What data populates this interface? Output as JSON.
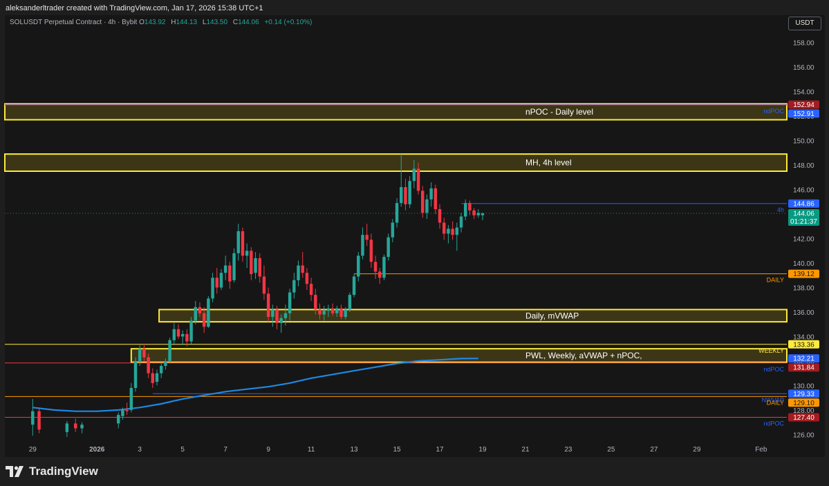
{
  "header": {
    "credit": "aleksanderltrader created with TradingView.com, Jan 17, 2026 15:38 UTC+1",
    "symbol": "SOLUSDT Perpetual Contract · 4h · Bybit",
    "ohlc": {
      "o_label": "O",
      "o": "143.92",
      "h_label": "H",
      "h": "144.13",
      "l_label": "L",
      "l": "143.50",
      "c_label": "C",
      "c": "144.06",
      "change": "+0.14 (+0.10%)"
    },
    "currency": "USDT"
  },
  "logo": {
    "text": "TradingView",
    "icon": "tradingview-logo-icon"
  },
  "chart_data": {
    "type": "candlestick",
    "ylim": [
      125.4,
      159.0
    ],
    "yticks": [
      "126.00",
      "128.00",
      "130.00",
      "132.00",
      "134.00",
      "136.00",
      "138.00",
      "140.00",
      "142.00",
      "144.00",
      "146.00",
      "148.00",
      "150.00",
      "152.00",
      "154.00",
      "156.00",
      "158.00"
    ],
    "xlim": [
      -1.3,
      35.2
    ],
    "xtick_labels": [
      {
        "pos": 0,
        "label": "29"
      },
      {
        "pos": 3,
        "label": "2026"
      },
      {
        "pos": 5,
        "label": "3"
      },
      {
        "pos": 7,
        "label": "5"
      },
      {
        "pos": 9,
        "label": "7"
      },
      {
        "pos": 11,
        "label": "9"
      },
      {
        "pos": 13,
        "label": "11"
      },
      {
        "pos": 15,
        "label": "13"
      },
      {
        "pos": 17,
        "label": "15"
      },
      {
        "pos": 19,
        "label": "17"
      },
      {
        "pos": 21,
        "label": "19"
      },
      {
        "pos": 23,
        "label": "21"
      },
      {
        "pos": 25,
        "label": "23"
      },
      {
        "pos": 27,
        "label": "25"
      },
      {
        "pos": 29,
        "label": "27"
      },
      {
        "pos": 31,
        "label": "29"
      },
      {
        "pos": 34,
        "label": "Feb"
      }
    ],
    "candles": [
      [
        0.0,
        126.8,
        128.9,
        125.9,
        127.9
      ],
      [
        0.3,
        127.9,
        128.2,
        126.1,
        126.4
      ],
      [
        1.6,
        126.2,
        127.1,
        125.8,
        126.9
      ],
      [
        2.0,
        126.9,
        127.3,
        126.2,
        126.5
      ],
      [
        2.3,
        126.5,
        127.0,
        126.1,
        126.8
      ],
      [
        4.0,
        126.9,
        127.8,
        126.5,
        127.6
      ],
      [
        4.2,
        127.5,
        128.2,
        127.2,
        128.0
      ],
      [
        4.4,
        128.0,
        128.6,
        127.6,
        127.9
      ],
      [
        4.6,
        128.0,
        130.2,
        127.8,
        129.8
      ],
      [
        4.8,
        129.8,
        132.3,
        129.5,
        132.0
      ],
      [
        5.0,
        132.0,
        133.3,
        131.6,
        133.0
      ],
      [
        5.2,
        133.0,
        133.4,
        132.0,
        132.3
      ],
      [
        5.4,
        132.3,
        132.6,
        130.6,
        131.0
      ],
      [
        5.6,
        131.0,
        131.4,
        129.8,
        130.2
      ],
      [
        5.8,
        130.3,
        131.3,
        130.0,
        131.0
      ],
      [
        6.0,
        131.0,
        131.9,
        130.6,
        131.6
      ],
      [
        6.2,
        131.6,
        132.2,
        131.3,
        132.0
      ],
      [
        6.4,
        132.0,
        133.9,
        131.9,
        133.7
      ],
      [
        6.6,
        133.7,
        135.1,
        133.3,
        134.6
      ],
      [
        6.8,
        134.6,
        135.0,
        133.8,
        134.0
      ],
      [
        7.0,
        134.0,
        134.5,
        133.3,
        134.2
      ],
      [
        7.2,
        134.2,
        134.6,
        133.2,
        133.6
      ],
      [
        7.4,
        133.6,
        135.6,
        133.4,
        135.3
      ],
      [
        7.6,
        135.3,
        136.9,
        135.0,
        136.4
      ],
      [
        7.8,
        136.4,
        136.8,
        135.6,
        135.9
      ],
      [
        8.0,
        135.9,
        136.4,
        134.3,
        134.8
      ],
      [
        8.2,
        134.8,
        137.3,
        134.7,
        137.1
      ],
      [
        8.4,
        137.1,
        139.2,
        136.8,
        138.8
      ],
      [
        8.6,
        138.8,
        139.6,
        137.5,
        138.0
      ],
      [
        8.8,
        138.0,
        139.5,
        137.8,
        139.2
      ],
      [
        9.0,
        139.2,
        140.6,
        138.6,
        139.8
      ],
      [
        9.2,
        139.8,
        140.1,
        137.9,
        138.5
      ],
      [
        9.4,
        138.6,
        141.2,
        138.4,
        140.8
      ],
      [
        9.6,
        140.8,
        143.2,
        140.2,
        142.6
      ],
      [
        9.8,
        142.6,
        142.9,
        140.1,
        140.6
      ],
      [
        10.0,
        140.6,
        141.6,
        139.6,
        141.0
      ],
      [
        10.2,
        141.0,
        141.3,
        138.6,
        139.1
      ],
      [
        10.4,
        139.2,
        140.9,
        138.7,
        140.4
      ],
      [
        10.6,
        140.4,
        140.8,
        138.4,
        138.9
      ],
      [
        10.8,
        138.9,
        139.8,
        137.0,
        137.5
      ],
      [
        11.0,
        137.5,
        138.0,
        135.2,
        135.6
      ],
      [
        11.2,
        135.6,
        136.6,
        134.8,
        136.2
      ],
      [
        11.4,
        136.2,
        136.5,
        134.6,
        135.1
      ],
      [
        11.6,
        135.1,
        135.8,
        134.3,
        135.5
      ],
      [
        11.8,
        135.5,
        136.6,
        134.9,
        135.9
      ],
      [
        12.0,
        135.9,
        137.9,
        135.3,
        137.6
      ],
      [
        12.2,
        137.6,
        139.2,
        137.1,
        138.6
      ],
      [
        12.4,
        138.6,
        140.2,
        138.1,
        139.8
      ],
      [
        12.6,
        139.8,
        140.9,
        138.8,
        139.2
      ],
      [
        12.8,
        139.2,
        139.6,
        137.8,
        138.3
      ],
      [
        13.0,
        138.3,
        138.8,
        136.9,
        137.4
      ],
      [
        13.2,
        137.4,
        137.9,
        135.8,
        136.2
      ],
      [
        13.4,
        136.2,
        136.7,
        135.4,
        135.8
      ],
      [
        13.6,
        135.8,
        136.5,
        135.3,
        136.1
      ],
      [
        13.8,
        136.1,
        136.6,
        135.6,
        136.3
      ],
      [
        14.0,
        136.3,
        136.7,
        135.7,
        135.9
      ],
      [
        14.2,
        135.9,
        136.5,
        135.6,
        136.3
      ],
      [
        14.4,
        136.3,
        136.6,
        135.4,
        135.6
      ],
      [
        14.6,
        135.6,
        136.4,
        135.4,
        136.2
      ],
      [
        14.8,
        136.2,
        137.6,
        136.0,
        137.4
      ],
      [
        15.0,
        137.4,
        139.1,
        137.2,
        138.9
      ],
      [
        15.2,
        138.9,
        140.9,
        138.5,
        140.6
      ],
      [
        15.4,
        140.6,
        142.9,
        140.3,
        142.3
      ],
      [
        15.6,
        142.3,
        143.2,
        141.4,
        141.9
      ],
      [
        15.8,
        141.9,
        142.4,
        139.6,
        140.1
      ],
      [
        16.0,
        140.1,
        140.6,
        138.7,
        139.3
      ],
      [
        16.2,
        139.3,
        139.6,
        138.3,
        138.8
      ],
      [
        16.4,
        138.8,
        140.7,
        138.6,
        140.5
      ],
      [
        16.6,
        140.5,
        142.4,
        140.2,
        142.1
      ],
      [
        16.8,
        142.1,
        143.6,
        141.7,
        143.3
      ],
      [
        17.0,
        143.3,
        145.3,
        142.9,
        144.9
      ],
      [
        17.2,
        144.9,
        148.9,
        144.6,
        146.2
      ],
      [
        17.4,
        146.2,
        146.9,
        144.3,
        144.8
      ],
      [
        17.6,
        144.8,
        147.1,
        144.5,
        146.7
      ],
      [
        17.8,
        146.7,
        148.4,
        146.1,
        147.7
      ],
      [
        18.0,
        147.7,
        148.2,
        145.6,
        145.9
      ],
      [
        18.2,
        145.9,
        146.3,
        143.7,
        144.1
      ],
      [
        18.4,
        144.1,
        145.6,
        143.6,
        145.2
      ],
      [
        18.6,
        145.2,
        146.6,
        144.6,
        146.1
      ],
      [
        18.8,
        146.1,
        146.4,
        144.0,
        144.4
      ],
      [
        19.0,
        144.4,
        144.8,
        142.8,
        143.3
      ],
      [
        19.2,
        143.3,
        143.7,
        141.9,
        142.4
      ],
      [
        19.4,
        142.4,
        143.1,
        141.6,
        142.8
      ],
      [
        19.6,
        142.8,
        143.4,
        141.9,
        142.3
      ],
      [
        19.8,
        142.3,
        143.3,
        141.0,
        142.9
      ],
      [
        20.0,
        142.9,
        144.1,
        142.5,
        143.8
      ],
      [
        20.2,
        143.8,
        145.2,
        143.5,
        144.9
      ],
      [
        20.4,
        144.9,
        145.1,
        143.9,
        144.3
      ],
      [
        20.6,
        144.3,
        144.5,
        143.6,
        143.9
      ],
      [
        20.8,
        143.9,
        144.4,
        143.7,
        144.1
      ],
      [
        21.0,
        143.9,
        144.13,
        143.5,
        144.06
      ]
    ],
    "vwap": [
      [
        0,
        128.2
      ],
      [
        1,
        128.0
      ],
      [
        2,
        127.9
      ],
      [
        3,
        127.9
      ],
      [
        4,
        128.0
      ],
      [
        5,
        128.2
      ],
      [
        6,
        128.5
      ],
      [
        7,
        128.9
      ],
      [
        8,
        129.2
      ],
      [
        9,
        129.5
      ],
      [
        10,
        129.7
      ],
      [
        11,
        129.9
      ],
      [
        12,
        130.2
      ],
      [
        13,
        130.6
      ],
      [
        14,
        130.9
      ],
      [
        15,
        131.2
      ],
      [
        16,
        131.5
      ],
      [
        17,
        131.8
      ],
      [
        18,
        132.0
      ],
      [
        19,
        132.1
      ],
      [
        20,
        132.2
      ],
      [
        20.8,
        132.21
      ]
    ],
    "zones": [
      {
        "label": "nPOC - Daily level",
        "from_x": -1.3,
        "to_x": 35.2,
        "top": 153.0,
        "bottom": 151.7,
        "label_x": 23.0
      },
      {
        "label": "MH, 4h level",
        "from_x": -1.3,
        "to_x": 35.2,
        "top": 148.9,
        "bottom": 147.5,
        "label_x": 23.0
      },
      {
        "label": "Daily, mVWAP",
        "from_x": 5.9,
        "to_x": 35.2,
        "top": 136.2,
        "bottom": 135.2,
        "label_x": 23.0
      },
      {
        "label": "PWL, Weekly, aVWAP + nPOC,",
        "from_x": 4.6,
        "to_x": 35.2,
        "top": 133.0,
        "bottom": 131.9,
        "label_x": 23.0
      }
    ],
    "levels": [
      {
        "price": 152.94,
        "label": "152.94",
        "side_label": "",
        "from_x": -1.3,
        "color": "#ff5252",
        "badge": "#a11d21",
        "dotted": false
      },
      {
        "price": 152.91,
        "label": "152.91",
        "side_label": "ndPOC",
        "from_x": -1.3,
        "color": "#2962ff",
        "badge": "#2962ff",
        "dotted": false
      },
      {
        "price": 144.86,
        "label": "144.86",
        "side_label": "4h",
        "from_x": 20.0,
        "color": "#2962ff",
        "badge": "#2962ff",
        "dotted": false
      },
      {
        "price": 144.06,
        "label": "144.06",
        "side_label": "",
        "from_x": -1.3,
        "color": "#26a69a",
        "badge": "#089981",
        "dotted": true,
        "sub": "01:21:37"
      },
      {
        "price": 139.12,
        "label": "139.12",
        "side_label": "DAILY",
        "from_x": 15.0,
        "color": "#ff9800",
        "badge": "#ff9800",
        "dotted": false
      },
      {
        "price": 133.36,
        "label": "133.36",
        "side_label": "WEEKLY",
        "from_x": -1.3,
        "color": "#ffeb3b",
        "badge": "#ffeb3b",
        "dotted": false
      },
      {
        "price": 132.21,
        "label": "132.21",
        "side_label": "",
        "from_x": -1.3,
        "color": "none",
        "badge": "#2962ff",
        "dotted": false
      },
      {
        "price": 131.84,
        "label": "131.84",
        "side_label": "ndPOC",
        "from_x": -1.3,
        "color": "#f23645",
        "badge": "#a11d21",
        "dotted": false
      },
      {
        "price": 129.33,
        "label": "129.33",
        "side_label": "NWVAP",
        "from_x": 5.6,
        "color": "#2962ff",
        "badge": "#2962ff",
        "dotted": false
      },
      {
        "price": 129.1,
        "label": "129.10",
        "side_label": "DAILY",
        "from_x": -1.3,
        "color": "#ff9800",
        "badge": "#ff9800",
        "dotted": false
      },
      {
        "price": 127.4,
        "label": "127.40",
        "side_label": "ndPOC",
        "from_x": -1.3,
        "color": "#f23645",
        "badge": "#a11d21",
        "dotted": false
      }
    ],
    "colors": {
      "up": "#26a69a",
      "down": "#f23645",
      "vwap": "#1e88e5",
      "zone_border": "#ffeb3b",
      "zone_fill": "#4a4218",
      "axis_text": "#b2b5be"
    },
    "grid": false
  }
}
